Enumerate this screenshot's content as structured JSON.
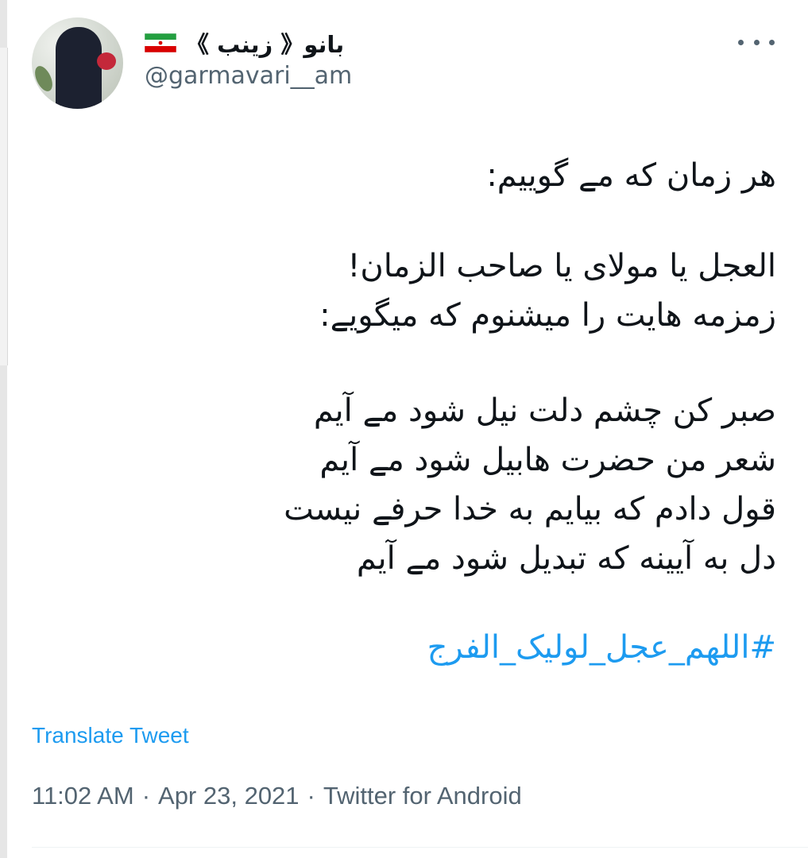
{
  "author": {
    "display_name": "بانو《 زینب 》",
    "handle": "@garmavari__am",
    "flag_icon": "iran-flag-icon"
  },
  "tweet": {
    "lines": [
      "هر زمان که مے گوییم:",
      "العجل یا مولای یا صاحب الزمان!",
      "زمزمه هایت را میشنوم که میگویے:",
      "صبر کن چشم دلت نیل شود مے آیم",
      "شعر من حضرت هابیل شود مے آیم",
      "قول دادم که بیایم به خدا حرفے نیست",
      "دل به آیینه که تبدیل شود مے آیم"
    ],
    "hashtag": "#اللهم_عجل_لولیک_الفرج"
  },
  "actions": {
    "translate_label": "Translate Tweet",
    "more_icon": "more-options-icon"
  },
  "meta": {
    "time": "11:02 AM",
    "separator": "·",
    "date": "Apr 23, 2021",
    "source": "Twitter for Android"
  },
  "colors": {
    "link": "#1d9bf0",
    "secondary_text": "#536471",
    "primary_text": "#0f1419"
  }
}
